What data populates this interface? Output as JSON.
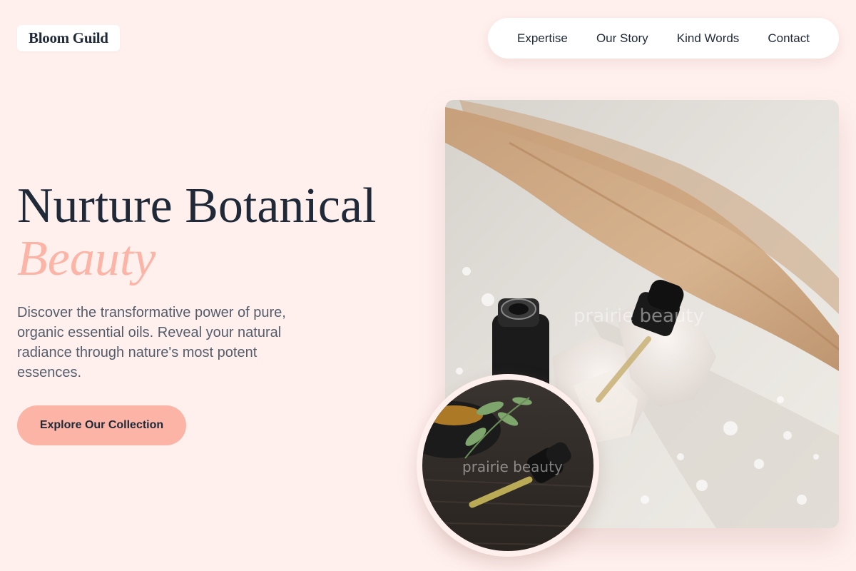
{
  "brand": {
    "name": "Bloom Guild"
  },
  "nav": {
    "items": [
      {
        "label": "Expertise"
      },
      {
        "label": "Our Story"
      },
      {
        "label": "Kind Words"
      },
      {
        "label": "Contact"
      }
    ]
  },
  "hero": {
    "title": "Nurture Botanical",
    "accent": "Beauty",
    "description": "Discover the transformative power of pure, organic essential oils. Reveal your natural radiance through nature's most potent essences.",
    "cta_label": "Explore Our Collection"
  },
  "images": {
    "main_watermark": "prairie beauty",
    "circle_watermark": "prairie beauty"
  },
  "colors": {
    "background": "#fff0ee",
    "accent": "#fbb4a5",
    "text": "#1f2937"
  }
}
